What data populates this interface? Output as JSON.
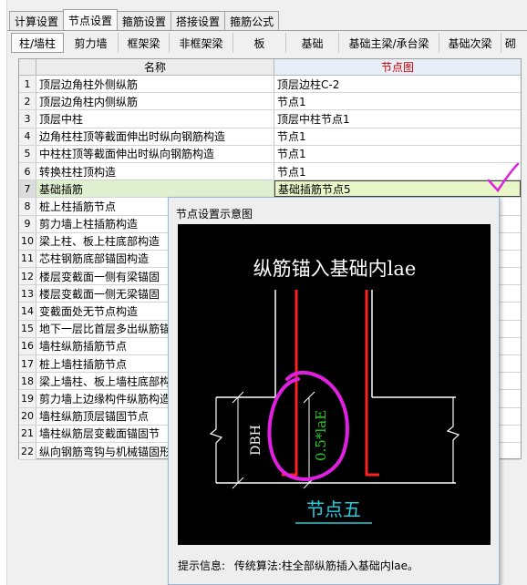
{
  "tabs": [
    "计算设置",
    "节点设置",
    "箍筋设置",
    "搭接设置",
    "箍筋公式"
  ],
  "subtabs": [
    "柱/墙柱",
    "剪力墙",
    "框架梁",
    "非框架梁",
    "板",
    "基础",
    "基础主梁/承台梁",
    "基础次梁",
    "砌"
  ],
  "grid": {
    "col_name": "名称",
    "col_node": "节点图",
    "rows": [
      {
        "num": "1",
        "name": "顶层边角柱外侧纵筋",
        "value": "顶层边柱C-2"
      },
      {
        "num": "2",
        "name": "顶层边角柱内侧纵筋",
        "value": "节点1"
      },
      {
        "num": "3",
        "name": "顶层中柱",
        "value": "顶层中柱节点1"
      },
      {
        "num": "4",
        "name": "边角柱柱顶等截面伸出时纵向钢筋构造",
        "value": "节点1"
      },
      {
        "num": "5",
        "name": "中柱柱顶等截面伸出时纵向钢筋构造",
        "value": "节点1"
      },
      {
        "num": "6",
        "name": "转换柱柱顶构造",
        "value": "节点1"
      },
      {
        "num": "7",
        "name": "基础插筋",
        "value": "基础插筋节点5"
      },
      {
        "num": "8",
        "name": "桩上柱插筋节点",
        "value": ""
      },
      {
        "num": "9",
        "name": "剪力墙上柱插筋构造",
        "value": ""
      },
      {
        "num": "10",
        "name": "梁上柱、板上柱底部构造",
        "value": ""
      },
      {
        "num": "11",
        "name": "芯柱钢筋底部锚固构造",
        "value": ""
      },
      {
        "num": "12",
        "name": "楼层变截面一侧有梁锚固",
        "value": ""
      },
      {
        "num": "13",
        "name": "楼层变截面一侧无梁锚固",
        "value": ""
      },
      {
        "num": "14",
        "name": "变截面处无节点构造",
        "value": ""
      },
      {
        "num": "15",
        "name": "地下一层比首层多出纵筋锚",
        "value": ""
      },
      {
        "num": "16",
        "name": "墙柱纵筋插筋节点",
        "value": ""
      },
      {
        "num": "17",
        "name": "桩上墙柱插筋节点",
        "value": ""
      },
      {
        "num": "18",
        "name": "梁上墙柱、板上墙柱底部构",
        "value": ""
      },
      {
        "num": "19",
        "name": "剪力墙上边缘构件纵筋构造",
        "value": ""
      },
      {
        "num": "20",
        "name": "墙柱纵筋顶层锚固节点",
        "value": ""
      },
      {
        "num": "21",
        "name": "墙柱纵筋层变截面锚固节",
        "value": ""
      },
      {
        "num": "22",
        "name": "纵向钢筋弯钩与机械锚固形",
        "value": ""
      }
    ]
  },
  "popup": {
    "title": "节点设置示意图",
    "diagram_title": "纵筋锚入基础内lae",
    "dim_left": "DBH",
    "dim_center": "0.5*laE",
    "caption": "节点五",
    "info_label": "提示信息:",
    "info_text": "传统算法:柱全部纵筋插入基础内lae。"
  },
  "colors": {
    "rebar": "#ff2020",
    "annotation_green": "#20d020",
    "caption_cyan": "#20d0e0",
    "highlight_magenta": "#e020e0"
  }
}
